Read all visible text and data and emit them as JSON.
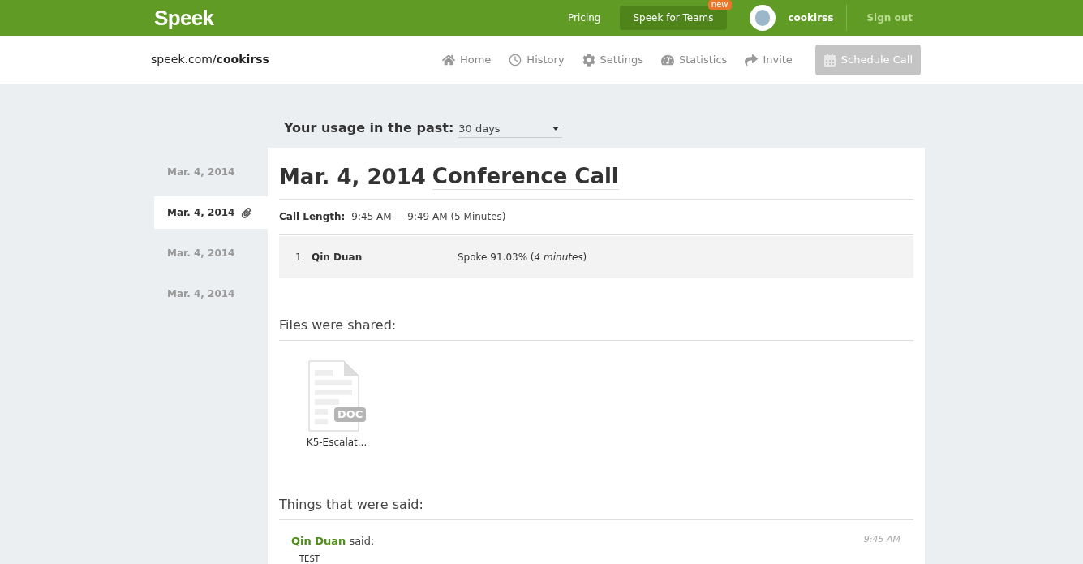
{
  "topbar": {
    "logo": "Speek",
    "links": [
      {
        "label": "Pricing",
        "selected": false
      },
      {
        "label": "Speek for Teams",
        "selected": true,
        "badge": "new"
      }
    ],
    "user": "cookirss",
    "signout": "Sign out"
  },
  "subbar": {
    "url_prefix": "speek.com/",
    "url_user": "cookirss",
    "nav": [
      {
        "label": "Home"
      },
      {
        "label": "History"
      },
      {
        "label": "Settings"
      },
      {
        "label": "Statistics"
      },
      {
        "label": "Invite"
      }
    ],
    "schedule": {
      "label": "Schedule Call",
      "disabled": true
    }
  },
  "usage": {
    "label": "Your usage in the past:",
    "value": "30 days"
  },
  "calls": [
    {
      "date": "Mar. 4, 2014",
      "selected": false,
      "attachment": false
    },
    {
      "date": "Mar. 4, 2014",
      "selected": true,
      "attachment": true
    },
    {
      "date": "Mar. 4, 2014",
      "selected": false,
      "attachment": false
    },
    {
      "date": "Mar. 4, 2014",
      "selected": false,
      "attachment": false
    }
  ],
  "detail": {
    "date": "Mar. 4, 2014",
    "title": "Conference Call",
    "length_label": "Call Length:",
    "length": "9:45 AM — 9:49 AM (5 Minutes)",
    "participants": [
      {
        "number": "1.",
        "name": "Qin Duan",
        "spoke": "Spoke 91.03% (*4 minutes*)"
      }
    ],
    "files_heading": "Files were shared:",
    "files": [
      {
        "type": "DOC",
        "name": "K5-Escalat..."
      }
    ],
    "said_heading": "Things that were said:",
    "messages": [
      {
        "author": "Qin Duan",
        "verb": "said:",
        "time": "9:45 AM",
        "text": "TEST"
      }
    ]
  }
}
